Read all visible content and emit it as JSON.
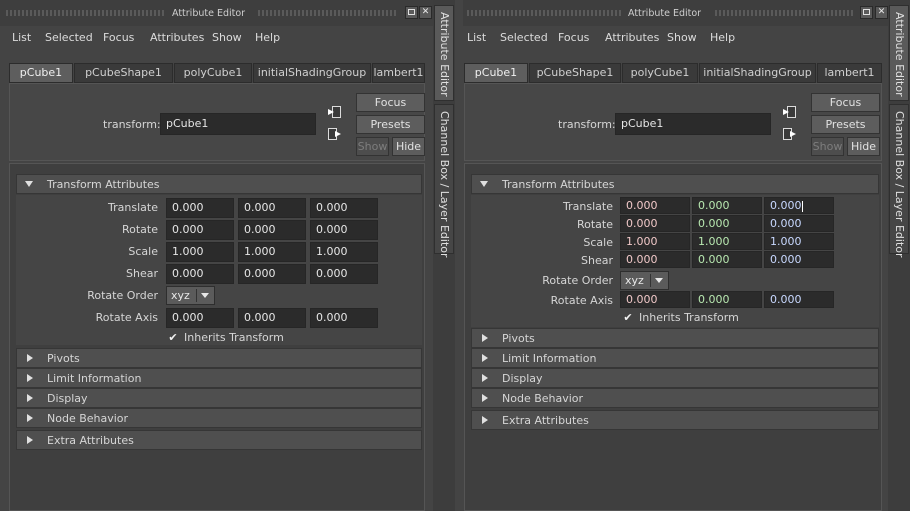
{
  "title": "Attribute Editor",
  "menu": [
    "List",
    "Selected",
    "Focus",
    "Attributes",
    "Show",
    "Help"
  ],
  "tabs": [
    "pCube1",
    "pCubeShape1",
    "polyCube1",
    "initialShadingGroup",
    "lambert1"
  ],
  "node": {
    "type_label": "transform:",
    "name": "pCube1"
  },
  "buttons": {
    "focus": "Focus",
    "presets": "Presets",
    "show": "Show",
    "hide": "Hide"
  },
  "transform_section": "Transform Attributes",
  "rows": {
    "translate": {
      "label": "Translate",
      "values": [
        "0.000",
        "0.000",
        "0.000"
      ]
    },
    "rotate": {
      "label": "Rotate",
      "values": [
        "0.000",
        "0.000",
        "0.000"
      ]
    },
    "scale": {
      "label": "Scale",
      "values": [
        "1.000",
        "1.000",
        "1.000"
      ]
    },
    "shear": {
      "label": "Shear",
      "values": [
        "0.000",
        "0.000",
        "0.000"
      ]
    },
    "rotate_axis": {
      "label": "Rotate Axis",
      "values": [
        "0.000",
        "0.000",
        "0.000"
      ]
    }
  },
  "rotate_order": {
    "label": "Rotate Order",
    "value": "xyz"
  },
  "inherits": {
    "label": "Inherits Transform",
    "checked": true
  },
  "collapsed_sections_a": [
    "Pivots",
    "Limit Information",
    "Display",
    "Node Behavior",
    "Extra Attributes"
  ],
  "collapsed_sections_b": [
    "Pivots",
    "Limit Information",
    "Display",
    "Node Behavior",
    "Extra Attributes"
  ],
  "side_tabs": {
    "attr_editor": "Attribute Editor",
    "channel_box": "Channel Box / Layer Editor"
  },
  "colors": {
    "field_bg": "#2b2b2b",
    "panel_bg": "#444444",
    "active_tab": "#5e5e5e"
  }
}
